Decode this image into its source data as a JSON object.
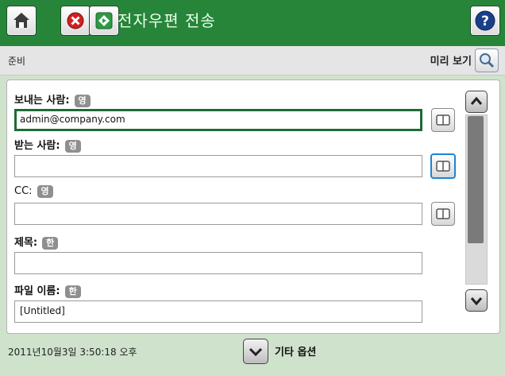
{
  "header": {
    "title": "전자우편 전송",
    "home_icon": "home-icon",
    "cancel_icon": "stop-icon",
    "start_icon": "start-icon",
    "help_icon": "help-icon",
    "bar_color": "#27853a"
  },
  "status": {
    "text": "준비",
    "preview_label": "미리 보기"
  },
  "form": {
    "from": {
      "label": "보내는 사람:",
      "badge": "영",
      "value": "admin@company.com"
    },
    "to": {
      "label": "받는 사람:",
      "badge": "영",
      "value": ""
    },
    "cc": {
      "label": "CC:",
      "badge": "영",
      "value": ""
    },
    "subject": {
      "label": "제목:",
      "badge": "한",
      "value": ""
    },
    "filename": {
      "label": "파일 이름:",
      "badge": "한",
      "value": "[Untitled]"
    }
  },
  "footer": {
    "datetime": "2011년10월3일 3:50:18 오후",
    "more_options_label": "기타 옵션"
  }
}
